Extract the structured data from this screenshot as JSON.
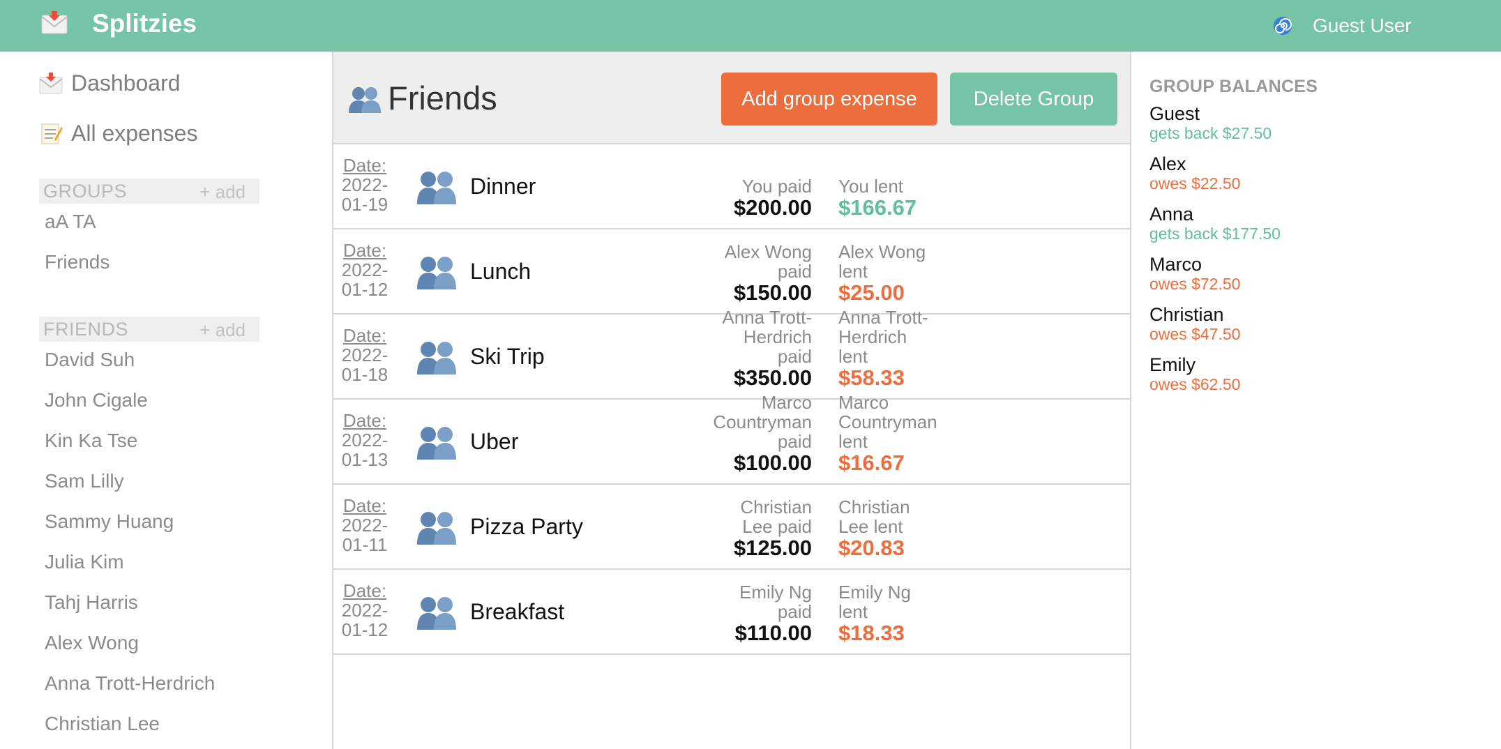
{
  "app": {
    "name": "Splitzies",
    "user": "Guest User",
    "colors": {
      "brand": "#76c4a6",
      "accent": "#ee6d3c",
      "positive": "#5fbf9a",
      "negative": "#ee6d3c"
    }
  },
  "nav": {
    "dashboard": {
      "label": "Dashboard",
      "icon": "envelope-icon"
    },
    "all_expenses": {
      "label": "All expenses",
      "icon": "memo-icon"
    }
  },
  "groups": {
    "title": "GROUPS",
    "add_label": "+ add",
    "items": [
      "aA TA",
      "Friends"
    ]
  },
  "friends": {
    "title": "FRIENDS",
    "add_label": "+ add",
    "items": [
      "David Suh",
      "John Cigale",
      "Kin Ka Tse",
      "Sam Lilly",
      "Sammy Huang",
      "Julia Kim",
      "Tahj Harris",
      "Alex Wong",
      "Anna Trott-Herdrich",
      "Christian Lee"
    ]
  },
  "group": {
    "title": "Friends",
    "add_expense_label": "Add group expense",
    "delete_label": "Delete Group"
  },
  "expenses": [
    {
      "date_label": "Date:",
      "date_l1": "2022-",
      "date_l2": "01-19",
      "description": "Dinner",
      "payer_lines": [
        "You paid"
      ],
      "paid": "$200.00",
      "lent_lines": [
        "You lent"
      ],
      "lent": "$166.67",
      "lent_kind": "positive"
    },
    {
      "date_label": "Date:",
      "date_l1": "2022-",
      "date_l2": "01-12",
      "description": "Lunch",
      "payer_lines": [
        "Alex Wong",
        "paid"
      ],
      "paid": "$150.00",
      "lent_lines": [
        "Alex Wong",
        "lent"
      ],
      "lent": "$25.00",
      "lent_kind": "negative"
    },
    {
      "date_label": "Date:",
      "date_l1": "2022-",
      "date_l2": "01-18",
      "description": "Ski Trip",
      "payer_lines": [
        "Anna Trott-",
        "Herdrich",
        "paid"
      ],
      "paid": "$350.00",
      "lent_lines": [
        "Anna Trott-",
        "Herdrich",
        "lent"
      ],
      "lent": "$58.33",
      "lent_kind": "negative"
    },
    {
      "date_label": "Date:",
      "date_l1": "2022-",
      "date_l2": "01-13",
      "description": "Uber",
      "payer_lines": [
        "Marco",
        "Countryman",
        "paid"
      ],
      "paid": "$100.00",
      "lent_lines": [
        "Marco",
        "Countryman",
        "lent"
      ],
      "lent": "$16.67",
      "lent_kind": "negative"
    },
    {
      "date_label": "Date:",
      "date_l1": "2022-",
      "date_l2": "01-11",
      "description": "Pizza Party",
      "payer_lines": [
        "Christian",
        "Lee paid"
      ],
      "paid": "$125.00",
      "lent_lines": [
        "Christian",
        "Lee lent"
      ],
      "lent": "$20.83",
      "lent_kind": "negative"
    },
    {
      "date_label": "Date:",
      "date_l1": "2022-",
      "date_l2": "01-12",
      "description": "Breakfast",
      "payer_lines": [
        "Emily Ng",
        "paid"
      ],
      "paid": "$110.00",
      "lent_lines": [
        "Emily Ng",
        "lent"
      ],
      "lent": "$18.33",
      "lent_kind": "negative"
    }
  ],
  "balances": {
    "title": "GROUP BALANCES",
    "items": [
      {
        "name": "Guest",
        "status": "gets back $27.50",
        "kind": "positive"
      },
      {
        "name": "Alex",
        "status": "owes $22.50",
        "kind": "negative"
      },
      {
        "name": "Anna",
        "status": "gets back $177.50",
        "kind": "positive"
      },
      {
        "name": "Marco",
        "status": "owes $72.50",
        "kind": "negative"
      },
      {
        "name": "Christian",
        "status": "owes $47.50",
        "kind": "negative"
      },
      {
        "name": "Emily",
        "status": "owes $62.50",
        "kind": "negative"
      }
    ]
  }
}
